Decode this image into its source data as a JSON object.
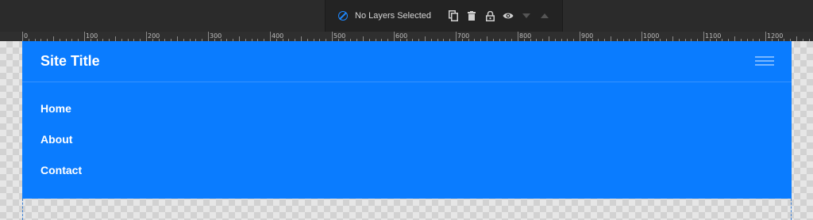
{
  "toolbar": {
    "status_text": "No Layers Selected",
    "icons": [
      "no-selection-icon",
      "duplicate-icon",
      "delete-icon",
      "lock-icon",
      "visibility-icon",
      "move-down-icon",
      "move-up-icon"
    ],
    "accent": "#1e88ff"
  },
  "ruler": {
    "labels": [
      "0",
      "100",
      "200",
      "300",
      "400",
      "500",
      "600",
      "700",
      "800",
      "900",
      "1000",
      "1100",
      "1200"
    ]
  },
  "site": {
    "background": "#0a7cff",
    "title": "Site Title",
    "nav": [
      "Home",
      "About",
      "Contact"
    ]
  }
}
